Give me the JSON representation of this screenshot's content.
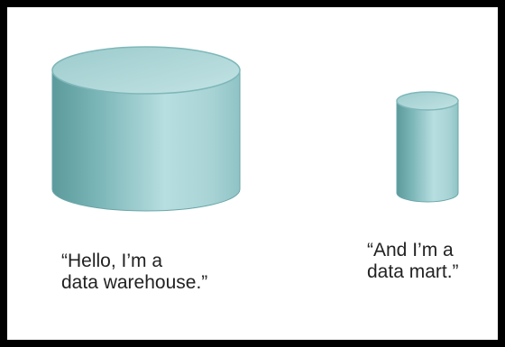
{
  "diagram": {
    "warehouse": {
      "name": "data warehouse",
      "caption_line1": "“Hello, I’m a",
      "caption_line2": "data warehouse.”"
    },
    "mart": {
      "name": "data mart",
      "caption_line1": "“And I’m a",
      "caption_line2": "data mart.”"
    },
    "colors": {
      "cylinder_body_dark": "#5e9c9e",
      "cylinder_body_light": "#b9dfe1",
      "cylinder_top": "#a9d2d4",
      "frame_border": "#000000"
    }
  }
}
